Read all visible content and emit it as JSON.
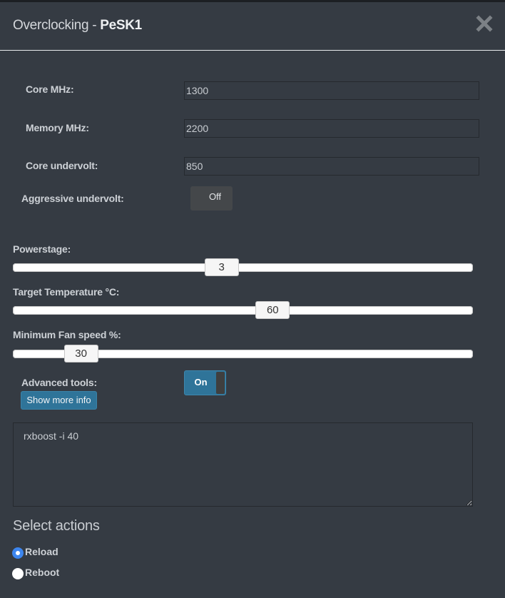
{
  "dialog": {
    "title_prefix": "Overclocking - ",
    "title_name": "PeSK1",
    "close_icon": "close-x-icon"
  },
  "fields": {
    "core_mhz": {
      "label": "Core MHz:",
      "value": "1300"
    },
    "memory_mhz": {
      "label": "Memory MHz:",
      "value": "2200"
    },
    "core_undervolt": {
      "label": "Core undervolt:",
      "value": "850"
    },
    "aggressive_undervolt": {
      "label": "Aggressive undervolt:",
      "state": "Off"
    }
  },
  "sliders": {
    "powerstage": {
      "label": "Powerstage:",
      "value": "3",
      "position_fraction": 0.45
    },
    "target_temp": {
      "label": "Target Temperature °C:",
      "value": "60",
      "position_fraction": 0.57
    },
    "min_fan": {
      "label": "Minimum Fan speed %:",
      "value": "30",
      "position_fraction": 0.12
    }
  },
  "advanced": {
    "label": "Advanced tools:",
    "toggle_state": "On",
    "info_button": "Show more info",
    "script": "rxboost -i 40"
  },
  "actions": {
    "title": "Select actions",
    "options": [
      {
        "label": "Reload",
        "checked": true
      },
      {
        "label": "Reboot",
        "checked": false
      }
    ]
  },
  "colors": {
    "background": "#353b43",
    "accent": "#2f7499",
    "radio_checked": "#3d86ef"
  }
}
